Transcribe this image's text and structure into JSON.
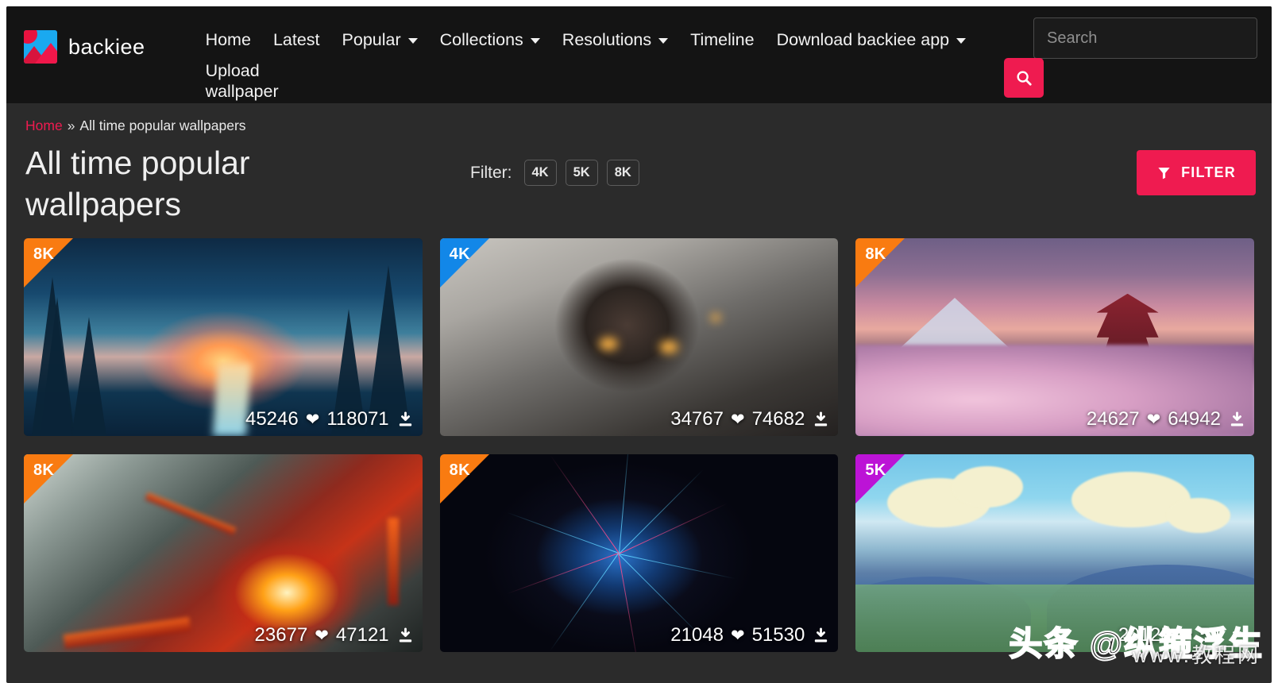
{
  "brand": {
    "name": "backiee",
    "logo_icon": "mountain-photo-icon"
  },
  "nav": {
    "items": [
      {
        "label": "Home",
        "has_dropdown": false
      },
      {
        "label": "Latest",
        "has_dropdown": false
      },
      {
        "label": "Popular",
        "has_dropdown": true
      },
      {
        "label": "Collections",
        "has_dropdown": true
      },
      {
        "label": "Resolutions",
        "has_dropdown": true
      },
      {
        "label": "Timeline",
        "has_dropdown": false
      },
      {
        "label": "Download backiee app",
        "has_dropdown": true
      },
      {
        "label": "Upload wallpaper",
        "has_dropdown": false
      }
    ]
  },
  "search": {
    "placeholder": "Search",
    "value": "",
    "button_icon": "search-icon"
  },
  "breadcrumb": {
    "home": "Home",
    "separator": "»",
    "current": "All time popular wallpapers"
  },
  "page_title": "All time popular wallpapers",
  "filter": {
    "label": "Filter:",
    "chips": [
      "4K",
      "5K",
      "8K"
    ],
    "button_label": "FILTER",
    "button_icon": "funnel-icon"
  },
  "colors": {
    "accent": "#ef1b50",
    "header_bg": "#141414",
    "page_bg": "#2b2b2b",
    "badge_4k": "#1287e8",
    "badge_5k": "#bc13d6",
    "badge_8k": "#f97b11"
  },
  "wallpapers": [
    {
      "badge": "8K",
      "likes": "45246",
      "downloads": "118071",
      "art": "art-forest"
    },
    {
      "badge": "4K",
      "likes": "34767",
      "downloads": "74682",
      "art": "art-hood"
    },
    {
      "badge": "8K",
      "likes": "24627",
      "downloads": "64942",
      "art": "art-fuji"
    },
    {
      "badge": "8K",
      "likes": "23677",
      "downloads": "47121",
      "art": "art-dragon"
    },
    {
      "badge": "8K",
      "likes": "21048",
      "downloads": "51530",
      "art": "art-plexus"
    },
    {
      "badge": "5K",
      "likes": "20125",
      "downloads": "54",
      "art": "art-valley"
    }
  ],
  "watermark": {
    "text": "头条 @纵箍浮生",
    "sub_text": "www.教程网"
  }
}
